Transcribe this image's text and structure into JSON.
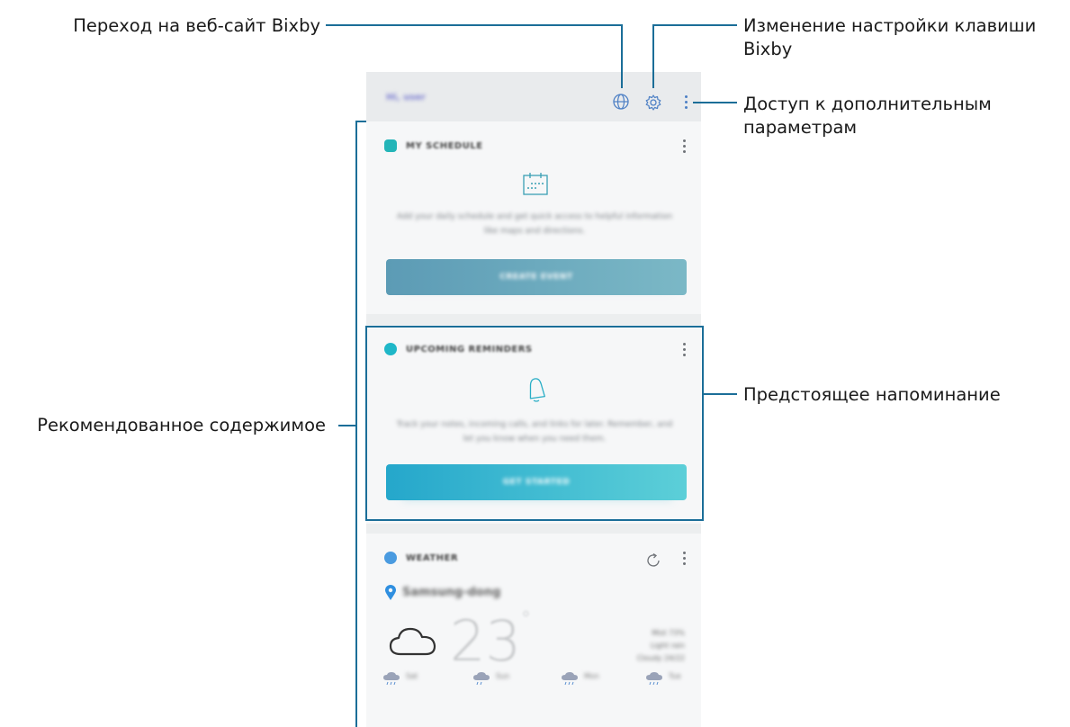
{
  "callouts": {
    "website": "Переход на веб-сайт Bixby",
    "settings_line1": "Изменение настройки клавиши",
    "settings_line2": "Bixby",
    "more_line1": "Доступ к дополнительным",
    "more_line2": "параметрам",
    "reminder": "Предстоящее напоминание",
    "recommended": "Рекомендованное содержимое"
  },
  "phone": {
    "appbar": {
      "title": "Hi, user"
    },
    "cards": [
      {
        "title": "MY SCHEDULE",
        "desc": "Add your daily schedule and get quick access to helpful information like maps and directions.",
        "button": "CREATE EVENT"
      },
      {
        "title": "UPCOMING REMINDERS",
        "desc": "Track your notes, incoming calls, and links for later. Remember, and let you know when you need them.",
        "button": "GET STARTED"
      },
      {
        "title": "WEATHER",
        "location": "Samsung-dong",
        "temp": "23",
        "unit": "°",
        "details": [
          "Mist 73%",
          "Light rain",
          "Cloudy 24/22"
        ],
        "forecast": [
          "Sat",
          "Sun",
          "Mon",
          "Tue"
        ]
      }
    ]
  },
  "colors": {
    "accent": "#1b6e98",
    "button1": "#6aa6bd",
    "button2": "#39b6d3"
  }
}
